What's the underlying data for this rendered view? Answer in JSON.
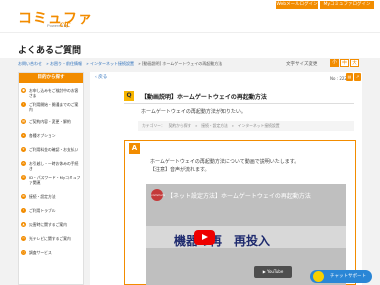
{
  "header": {
    "logo": "コミュファ",
    "logo_sub": "Powered by",
    "logo_brand": "ctc",
    "login1": "Webメールログイン",
    "login2": "Myコミュファログイン"
  },
  "page_title": "よくあるご質問",
  "breadcrumb": [
    "お問い合わせ",
    "» お困り・前住情報",
    "» インターネット接続設置",
    "» [動画説明] ホームゲートウェイの再起動方法"
  ],
  "font_size": {
    "label": "文字サイズ変更",
    "small": "小",
    "medium": "中",
    "large": "大"
  },
  "sidebar": {
    "header": "目的から探す",
    "items": [
      {
        "label": "お申し込みをご検討中のお客さま",
        "icon": "person-icon"
      },
      {
        "label": "ご利用開始・開通までのご案内",
        "icon": "info-icon"
      },
      {
        "label": "ご契約内容・変更・解約",
        "icon": "document-icon"
      },
      {
        "label": "各種オプション",
        "icon": "option-icon"
      },
      {
        "label": "ご利用料金の確認・お支払い",
        "icon": "yen-icon"
      },
      {
        "label": "お引越し・一時お休みの手続き",
        "icon": "home-icon"
      },
      {
        "label": "ID・パスワード・Myコミュファ関連",
        "icon": "key-icon"
      },
      {
        "label": "接続・設定方法",
        "icon": "settings-icon"
      },
      {
        "label": "ご利用トラブル",
        "icon": "warning-icon"
      },
      {
        "label": "災害時に関するご案内",
        "icon": "disaster-icon"
      },
      {
        "label": "光テレビに関するご案内",
        "icon": "tv-icon"
      },
      {
        "label": "調査サービス",
        "icon": "search-icon"
      }
    ]
  },
  "back": "戻る",
  "meta": {
    "no": "No : 2226"
  },
  "question": {
    "badge": "Q",
    "title": "【動画説明】ホームゲートウェイの再起動方法",
    "body": "ホームゲートウェイの再起動方法が知りたい。",
    "category": "カテゴリー：　契約から探す　»　接続・設定方法　»　インターネット接続設置"
  },
  "answer": {
    "badge": "A",
    "line1": "ホームゲートウェイの再起動方法について動画で説明いたします。",
    "line2": "【注意】音声が流れます。"
  },
  "video": {
    "channel": "commufa",
    "title": "【ネット設定方法】ホームゲートウェイの再起動方法",
    "banner": "機器の再　再投入",
    "youtube": "▶ YouTube"
  },
  "chat": "チャットサポート"
}
